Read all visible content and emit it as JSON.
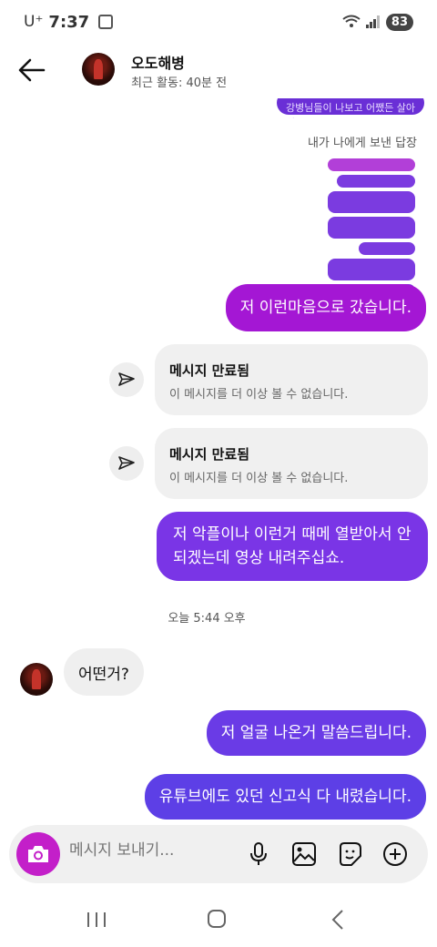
{
  "status_bar": {
    "carrier": "U⁺",
    "time": "7:37",
    "battery": "83"
  },
  "header": {
    "name": "오도해병",
    "activity": "최근 활동: 40분 전"
  },
  "story_reply": {
    "note": "내가 나에게 보낸 답장",
    "clipped_text": "강병님들이 나보고 어쨌든 살아서"
  },
  "messages": {
    "sent_1": "저 이런마음으로 갔습니다.",
    "expired_1": {
      "title": "메시지 만료됨",
      "subtitle": "이 메시지를 더 이상 볼 수 없습니다."
    },
    "expired_2": {
      "title": "메시지 만료됨",
      "subtitle": "이 메시지를 더 이상 볼 수 없습니다."
    },
    "sent_2": "저 악플이나 이런거 때메 열받아서 안되겠는데 영상 내려주십쇼.",
    "timestamp": "오늘 5:44 오후",
    "received_1": "어떤거?",
    "sent_3": "저 얼굴 나온거 말씀드립니다.",
    "sent_4": "유튜브에도 있던 신고식 다 내렸습니다."
  },
  "composer": {
    "placeholder": "메시지 보내기..."
  },
  "colors": {
    "accent_magenta": "#a417d4",
    "accent_purple": "#6a3be6",
    "camera_button": "#c31fc9"
  }
}
